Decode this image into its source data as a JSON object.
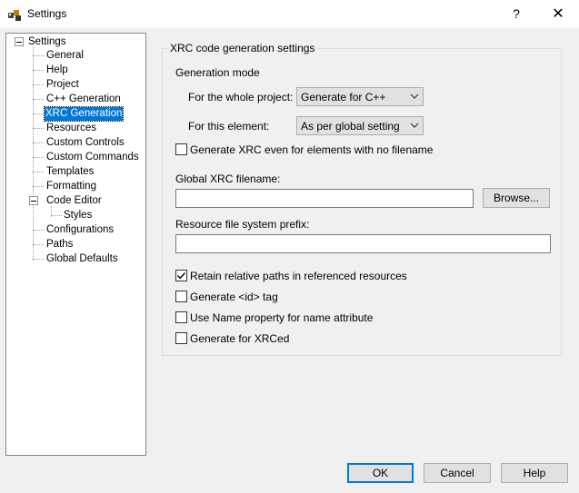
{
  "window": {
    "title": "Settings",
    "help_glyph": "?",
    "close_glyph": "✕"
  },
  "tree": {
    "root": "Settings",
    "items": [
      {
        "label": "General"
      },
      {
        "label": "Help"
      },
      {
        "label": "Project"
      },
      {
        "label": "C++ Generation"
      },
      {
        "label": "XRC Generation",
        "selected": true
      },
      {
        "label": "Resources"
      },
      {
        "label": "Custom Controls"
      },
      {
        "label": "Custom Commands"
      },
      {
        "label": "Templates"
      },
      {
        "label": "Formatting"
      },
      {
        "label": "Code Editor",
        "expanded": true
      },
      {
        "label": "Styles",
        "child": true
      },
      {
        "label": "Configurations"
      },
      {
        "label": "Paths"
      },
      {
        "label": "Global Defaults"
      }
    ]
  },
  "xrc": {
    "group_title": "XRC code generation settings",
    "generation_mode_label": "Generation mode",
    "whole_project_label": "For the whole project:",
    "whole_project_value": "Generate for C++",
    "this_element_label": "For this element:",
    "this_element_value": "As per global setting",
    "gen_no_filename_label": "Generate XRC even for elements with no filename",
    "gen_no_filename_checked": false,
    "global_filename_label": "Global XRC filename:",
    "global_filename_value": "",
    "browse_label": "Browse...",
    "resource_prefix_label": "Resource file system prefix:",
    "resource_prefix_value": "",
    "retain_paths_label": "Retain relative paths in referenced resources",
    "retain_paths_checked": true,
    "generate_id_label": "Generate <id> tag",
    "generate_id_checked": false,
    "use_name_label": "Use Name property for name attribute",
    "use_name_checked": false,
    "xrced_label": "Generate for XRCed",
    "xrced_checked": false
  },
  "buttons": {
    "ok": "OK",
    "cancel": "Cancel",
    "help": "Help"
  },
  "colors": {
    "selection": "#0078d7",
    "dialog_bg": "#f0f0f0"
  }
}
